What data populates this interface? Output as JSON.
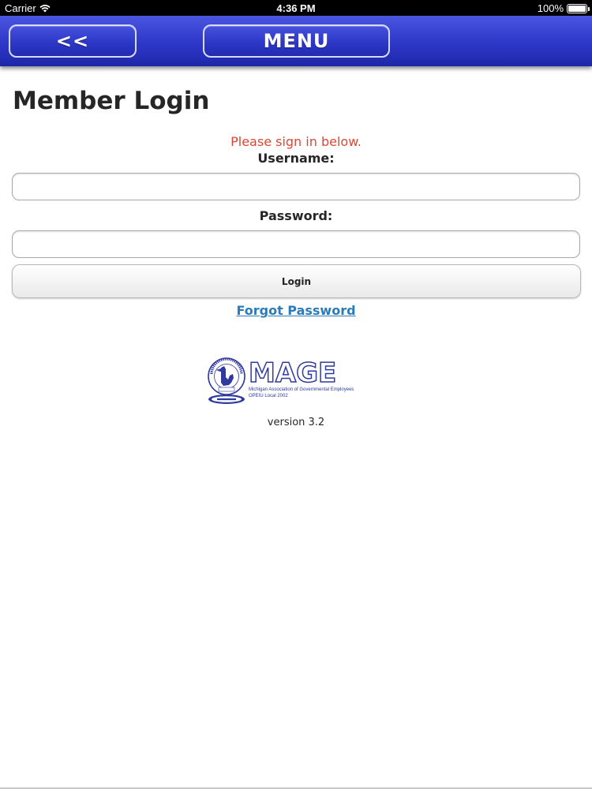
{
  "status_bar": {
    "carrier": "Carrier",
    "time": "4:36 PM",
    "battery": "100%"
  },
  "nav": {
    "back_label": "<<",
    "menu_label": "MENU"
  },
  "page": {
    "title": "Member Login",
    "prompt": "Please sign in below.",
    "username_label": "Username:",
    "username_value": "",
    "password_label": "Password:",
    "password_value": "",
    "login_label": "Login",
    "forgot_label": "Forgot Password"
  },
  "logo": {
    "wordmark": "MAGE",
    "line1": "Michigan Association of Governmental Employees",
    "line2": "OPEIU Local 2002"
  },
  "version": "version 3.2",
  "colors": {
    "nav_blue": "#2e38c8",
    "prompt_red": "#e2452f",
    "link_blue": "#2b7bb9",
    "logo_blue": "#2e3a9e"
  },
  "icons": {
    "wifi": "wifi-icon",
    "battery": "battery-icon"
  }
}
